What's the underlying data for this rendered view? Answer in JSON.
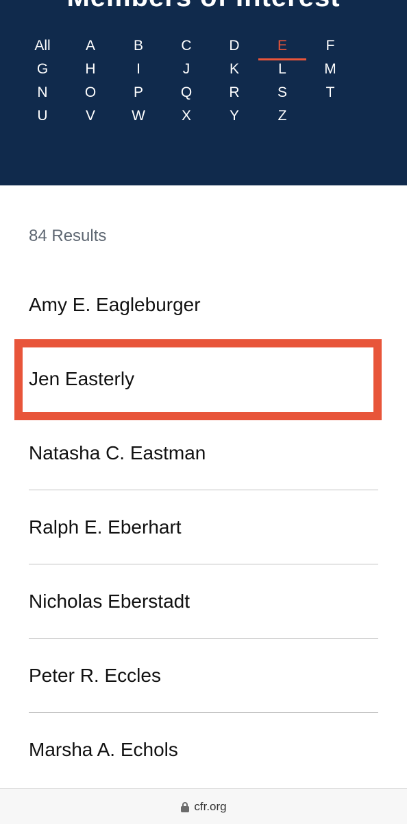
{
  "header": {
    "title": "Members of Interest",
    "letters": [
      "All",
      "A",
      "B",
      "C",
      "D",
      "E",
      "F",
      "G",
      "H",
      "I",
      "J",
      "K",
      "L",
      "M",
      "N",
      "O",
      "P",
      "Q",
      "R",
      "S",
      "T",
      "U",
      "V",
      "W",
      "X",
      "Y",
      "Z"
    ],
    "active_letter": "E"
  },
  "results": {
    "count_label": "84 Results"
  },
  "people": [
    "Amy E. Eagleburger",
    "Jen Easterly",
    "Natasha C. Eastman",
    "Ralph E. Eberhart",
    "Nicholas Eberstadt",
    "Peter R. Eccles",
    "Marsha A. Echols"
  ],
  "highlight_index": 1,
  "browser": {
    "url": "cfr.org",
    "lock_icon": "lock-icon"
  },
  "colors": {
    "header_bg": "#102a4c",
    "accent": "#e8553a"
  }
}
